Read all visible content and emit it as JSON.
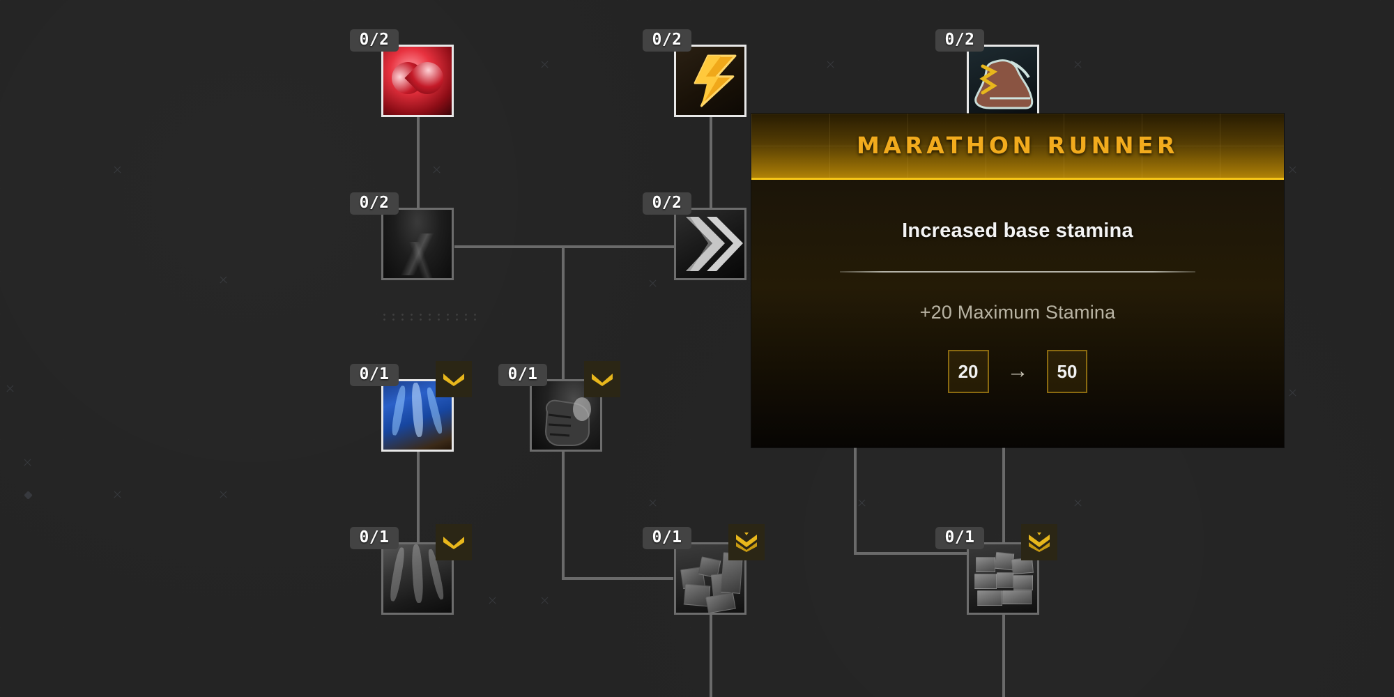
{
  "screen": {
    "kind": "skill-tree",
    "background_color": "#242424",
    "link_color": "#6a6a6a"
  },
  "tooltip": {
    "title": "MARATHON RUNNER",
    "description": "Increased base stamina",
    "effect": "+20 Maximum Stamina",
    "value_from": "20",
    "arrow": "→",
    "value_to": "50",
    "accent_color": "#f2ab1d",
    "border_color": "#f5c518"
  },
  "nodes": [
    {
      "id": "health",
      "rank": "0/2",
      "icon": "heart-icon",
      "state": "active",
      "tier": null
    },
    {
      "id": "stamina-bolt",
      "rank": "0/2",
      "icon": "lightning-bolt-icon",
      "state": "active",
      "tier": null
    },
    {
      "id": "marathon-boot",
      "rank": "0/2",
      "icon": "boot-lightning-icon",
      "state": "active",
      "tier": null
    },
    {
      "id": "dark-chest",
      "rank": "0/2",
      "icon": "dark-chestplate-icon",
      "state": "locked",
      "tier": null
    },
    {
      "id": "speed-chevron",
      "rank": "0/2",
      "icon": "chevron-speed-icon",
      "state": "locked",
      "tier": null
    },
    {
      "id": "blue-cloth",
      "rank": "0/1",
      "icon": "blue-cloth-icon",
      "state": "active",
      "tier": "single-chevron"
    },
    {
      "id": "fist",
      "rank": "0/1",
      "icon": "fist-icon",
      "state": "locked",
      "tier": "single-chevron"
    },
    {
      "id": "grey-cloth",
      "rank": "0/1",
      "icon": "grey-cloth-icon",
      "state": "locked",
      "tier": "single-chevron"
    },
    {
      "id": "rubble",
      "rank": "0/1",
      "icon": "rubble-icon",
      "state": "locked",
      "tier": "double-chevron"
    },
    {
      "id": "stone-blocks",
      "rank": "0/1",
      "icon": "stone-blocks-icon",
      "state": "locked",
      "tier": "double-chevron"
    }
  ]
}
